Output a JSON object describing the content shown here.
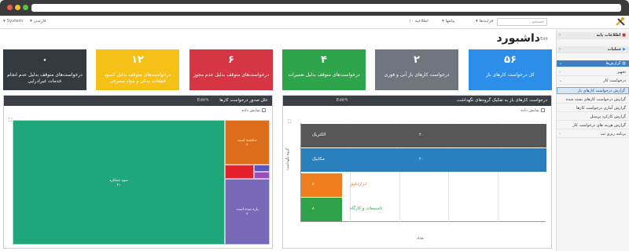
{
  "topnav": {
    "search_placeholder": "جستجو...",
    "processes": "فرایندها",
    "messages": "پیامها",
    "notifications": "۱۰ اطلاعیه",
    "language": "فارسی",
    "system": "System"
  },
  "sidebar": {
    "items": [
      {
        "label": "اطلاعات پایه"
      },
      {
        "label": "عملیات"
      },
      {
        "label": "گزارش‌ها"
      },
      {
        "label": "تجهیز"
      },
      {
        "label": "درخواست کار"
      },
      {
        "label": "گزارش درخواست کارهای باز"
      },
      {
        "label": "گزارش درخواست کارهای بسته شده"
      },
      {
        "label": "گزارش آماری درخواست کارها"
      },
      {
        "label": "گزارش کارکرد پرسنل"
      },
      {
        "label": "گزارش هزینه های درخواست کار"
      },
      {
        "label": "برنامه ریزی نت"
      }
    ]
  },
  "page": {
    "title": "داشبورد",
    "edit": "Edit"
  },
  "cards": [
    {
      "value": "۵۶",
      "label": "کل درخواست کارهای باز",
      "color": "#2c8ee8"
    },
    {
      "value": "۲",
      "label": "درخواست کارهای باز آنی و فوری",
      "color": "#6f767d"
    },
    {
      "value": "۴",
      "label": "درخواست‌های متوقف بدلیل تعمیرات",
      "color": "#2ea54a"
    },
    {
      "value": "۶",
      "label": "درخواست‌های متوقف بدلیل عدم مجوز",
      "color": "#d63544"
    },
    {
      "value": "۱۲",
      "label": "درخواست‌های متوقف بدلیل کمبود قطعات یدکی و مواد مصرفی",
      "color": "#f5c117"
    },
    {
      "value": "۰",
      "label": "درخواست‌های متوقف بدلیل عدم انجام خدمات غیرادرایی",
      "color": "#353a40"
    }
  ],
  "panel_right": {
    "title": "درخواست کارهای باز به تفکیک گروه‌های نگهداشت",
    "edit": "Edit",
    "show_data": "نمایش داده",
    "xlabel": "تعداد",
    "ylabel": "گروه نگهداشت"
  },
  "panel_left": {
    "title": "علل صدور درخواست کارها",
    "edit": "Edit",
    "show_data": "نمایش داده"
  },
  "chart_data": [
    {
      "type": "bar",
      "orientation": "horizontal",
      "categories": [
        "الکتریک",
        "مکانیک",
        "ابزاردقیق",
        "تاسیسات و کارگاه"
      ],
      "values": [
        20,
        20,
        8,
        8
      ],
      "value_labels": [
        "۲۰",
        "۲۰",
        "۸",
        "۸"
      ],
      "colors": [
        "#575757",
        "#2a7fbd",
        "#ef7e1f",
        "#2fa34a"
      ]
    },
    {
      "type": "treemap",
      "categories": [
        "سوء عملکرد",
        "شکسته است",
        "پاره شده است",
        "",
        "",
        ""
      ],
      "values": [
        21,
        3,
        3,
        1,
        1,
        1
      ],
      "value_labels": [
        "۲۱",
        "۳",
        "۳",
        "",
        "",
        ""
      ],
      "colors": [
        "#1fa67a",
        "#dd6d1b",
        "#7869b8",
        "#e3202b",
        "#5a55c0",
        "#9a4fb7"
      ]
    }
  ],
  "colors": {
    "header_dark": "#3b3f45",
    "sidebar_active": "#3f7fbf"
  }
}
